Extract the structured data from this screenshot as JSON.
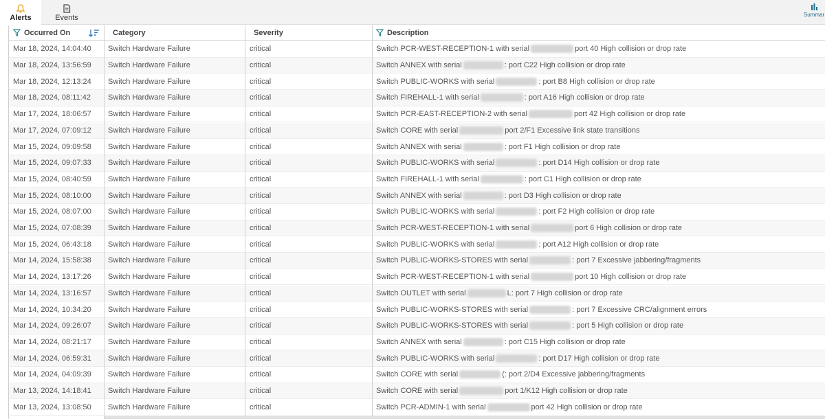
{
  "tabs": [
    {
      "label": "Alerts",
      "icon": "bell-icon"
    },
    {
      "label": "Events",
      "icon": "document-icon"
    },
    {
      "label": "Summar",
      "icon": "bar-chart-icon"
    }
  ],
  "columns": {
    "occurred_on": "Occurred On",
    "category": "Category",
    "severity": "Severity",
    "description": "Description"
  },
  "rows": [
    {
      "date": "Mar 18, 2024, 14:04:40",
      "category": "Switch Hardware Failure",
      "severity": "critical",
      "pre": "Switch PCR-WEST-RECEPTION-1 with serial",
      "post": "port 40 High collision or drop rate"
    },
    {
      "date": "Mar 18, 2024, 13:56:59",
      "category": "Switch Hardware Failure",
      "severity": "critical",
      "pre": "Switch ANNEX with serial",
      "post": ": port C22 High collision or drop rate"
    },
    {
      "date": "Mar 18, 2024, 12:13:24",
      "category": "Switch Hardware Failure",
      "severity": "critical",
      "pre": "Switch PUBLIC-WORKS with serial",
      "post": ": port B8 High collision or drop rate"
    },
    {
      "date": "Mar 18, 2024, 08:11:42",
      "category": "Switch Hardware Failure",
      "severity": "critical",
      "pre": "Switch FIREHALL-1 with serial",
      "post": ": port A16 High collision or drop rate"
    },
    {
      "date": "Mar 17, 2024, 18:06:57",
      "category": "Switch Hardware Failure",
      "severity": "critical",
      "pre": "Switch PCR-EAST-RECEPTION-2 with serial",
      "post": "port 42 High collision or drop rate"
    },
    {
      "date": "Mar 17, 2024, 07:09:12",
      "category": "Switch Hardware Failure",
      "severity": "critical",
      "pre": "Switch CORE with serial",
      "post": "port 2/F1 Excessive link state transitions"
    },
    {
      "date": "Mar 15, 2024, 09:09:58",
      "category": "Switch Hardware Failure",
      "severity": "critical",
      "pre": "Switch ANNEX with serial",
      "post": ": port F1 High collision or drop rate"
    },
    {
      "date": "Mar 15, 2024, 09:07:33",
      "category": "Switch Hardware Failure",
      "severity": "critical",
      "pre": "Switch PUBLIC-WORKS with serial",
      "post": ": port D14 High collision or drop rate"
    },
    {
      "date": "Mar 15, 2024, 08:40:59",
      "category": "Switch Hardware Failure",
      "severity": "critical",
      "pre": "Switch FIREHALL-1 with serial",
      "post": ": port C1 High collision or drop rate"
    },
    {
      "date": "Mar 15, 2024, 08:10:00",
      "category": "Switch Hardware Failure",
      "severity": "critical",
      "pre": "Switch ANNEX with serial",
      "post": ": port D3 High collision or drop rate"
    },
    {
      "date": "Mar 15, 2024, 08:07:00",
      "category": "Switch Hardware Failure",
      "severity": "critical",
      "pre": "Switch PUBLIC-WORKS with serial",
      "post": ": port F2 High collision or drop rate"
    },
    {
      "date": "Mar 15, 2024, 07:08:39",
      "category": "Switch Hardware Failure",
      "severity": "critical",
      "pre": "Switch PCR-WEST-RECEPTION-1 with serial",
      "post": "port 6 High collision or drop rate"
    },
    {
      "date": "Mar 15, 2024, 06:43:18",
      "category": "Switch Hardware Failure",
      "severity": "critical",
      "pre": "Switch PUBLIC-WORKS with serial",
      "post": ": port A12 High collision or drop rate"
    },
    {
      "date": "Mar 14, 2024, 15:58:38",
      "category": "Switch Hardware Failure",
      "severity": "critical",
      "pre": "Switch PUBLIC-WORKS-STORES with serial",
      "post": ": port 7 Excessive jabbering/fragments"
    },
    {
      "date": "Mar 14, 2024, 13:17:26",
      "category": "Switch Hardware Failure",
      "severity": "critical",
      "pre": "Switch PCR-WEST-RECEPTION-1 with serial",
      "post": "port 10 High collision or drop rate"
    },
    {
      "date": "Mar 14, 2024, 13:16:57",
      "category": "Switch Hardware Failure",
      "severity": "critical",
      "pre": "Switch OUTLET with serial",
      "post": "L: port 7 High collision or drop rate"
    },
    {
      "date": "Mar 14, 2024, 10:34:20",
      "category": "Switch Hardware Failure",
      "severity": "critical",
      "pre": "Switch PUBLIC-WORKS-STORES with serial",
      "post": ": port 7 Excessive CRC/alignment errors"
    },
    {
      "date": "Mar 14, 2024, 09:26:07",
      "category": "Switch Hardware Failure",
      "severity": "critical",
      "pre": "Switch PUBLIC-WORKS-STORES with serial",
      "post": ": port 5 High collision or drop rate"
    },
    {
      "date": "Mar 14, 2024, 08:21:17",
      "category": "Switch Hardware Failure",
      "severity": "critical",
      "pre": "Switch ANNEX with serial",
      "post": ": port C15 High collision or drop rate"
    },
    {
      "date": "Mar 14, 2024, 06:59:31",
      "category": "Switch Hardware Failure",
      "severity": "critical",
      "pre": "Switch PUBLIC-WORKS with serial",
      "post": ": port D17 High collision or drop rate"
    },
    {
      "date": "Mar 14, 2024, 04:09:39",
      "category": "Switch Hardware Failure",
      "severity": "critical",
      "pre": "Switch CORE with serial",
      "post": "(: port 2/D4 Excessive jabbering/fragments"
    },
    {
      "date": "Mar 13, 2024, 14:18:41",
      "category": "Switch Hardware Failure",
      "severity": "critical",
      "pre": "Switch CORE with serial",
      "post": "port 1/K12 High collision or drop rate"
    },
    {
      "date": "Mar 13, 2024, 13:08:50",
      "category": "Switch Hardware Failure",
      "severity": "critical",
      "pre": "Switch PCR-ADMIN-1 with serial",
      "post": "port 42 High collision or drop rate"
    }
  ],
  "colors": {
    "accent": "#e8a21a",
    "filter": "#2f8a8a",
    "sort": "#2a6fb0"
  }
}
